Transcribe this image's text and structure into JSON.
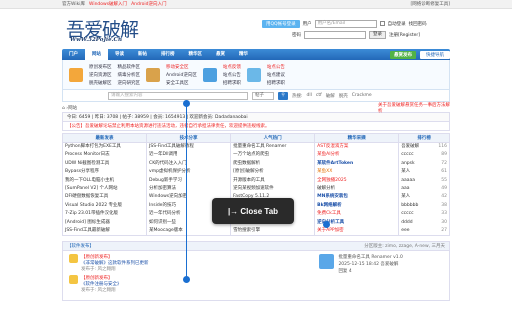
{
  "topbar": {
    "left": "官方Wiki库",
    "left_link": "Windows破解入门",
    "left_link2": "Android逆向入门",
    "right": "[网络诊断修复工具]"
  },
  "logo": {
    "big": "吾爱破解",
    "url": "WwW.52PoJie.Cn"
  },
  "login": {
    "qq": "用QQ帐号登录",
    "user_ph": "用户名/Email",
    "pass_ph": "",
    "autologin": "自动登录",
    "find_pw": "找回密码",
    "login_btn": "登录",
    "register": "注册[Register]"
  },
  "nav": {
    "items": [
      "门户",
      "网站",
      "导读",
      "新帖",
      "排行榜",
      "精华区",
      "悬赏",
      "精华"
    ],
    "green": "悬赏发布",
    "quick": "快捷导航"
  },
  "subnav": {
    "c1": [
      "原创发布区",
      "逆向资源区",
      "脱壳破解区"
    ],
    "c2": [
      "精品软件区",
      "病毒分析区",
      "逆向研究区"
    ],
    "c3": [
      "移动安全区",
      "Android逆向区",
      "安全工具区"
    ],
    "c4": [
      "站点反馈",
      "站点公告",
      "招聘求职"
    ],
    "c5": [
      "站点公告",
      "站点建议",
      "招聘求职"
    ]
  },
  "search": {
    "placeholder": "请输入搜索内容",
    "select": "帖子",
    "hot_label": "热搜:",
    "hot": [
      "dll",
      "ctf",
      "破解",
      "脱壳",
      "Crackme"
    ]
  },
  "crumb": "网站",
  "stats": {
    "left": "今日: 6459 | 昨日: 3708 | 帖子: 38959 | 会员: 1654913 | 欢迎新会员: Dadadanaobai",
    "right": "关于吾爱破解悬赏任务—事后方法解析"
  },
  "notice": "【公告】吾爱破解论坛禁止利用本站资源进行违法活动，违者自行承担法律责任，欢迎提供违规线索。",
  "rightad": "关于吾爱破解悬赏任务—事后方法解析",
  "grid": {
    "heads": [
      "最新发表",
      "技术分享",
      "人气热门",
      "精华采撷",
      "排行榜"
    ],
    "col1": [
      "Python脚本打包为EXE工具",
      "Process Monitor日志",
      "UDW Ni截图检测工具",
      "Bypass分享程序",
      "我的一下OLL电脑小主机",
      "[SumPanel V2] 个人网站",
      "DFl硬盘数据恢复工具",
      "Visual Studio 2022 专业版",
      "7-Zip 23.01带插件汉化版",
      "[Android] 图标生成器",
      "JSS-Find工具最新破解"
    ],
    "col2": [
      "JSS-Find工具破解教程",
      "近一年Dll调用",
      "CK的代码注入入门",
      "vmp虚拟机保护分析",
      "Debug新手学习",
      "分析加密算法",
      "Windows逆向加密",
      "Inside的技巧",
      "近一年代码分析",
      "如何识别一些",
      "某Moocage版本"
    ],
    "col3": [
      "批量重命名工具 Renamer",
      "一万个站点的爬虫",
      "爬虫数据解析",
      "[原创]破解分析",
      "开源版本的工具",
      "逆向某视频加速软件",
      "FastCopy 5.11.2",
      "CloudNode网络工具",
      "Screenshot",
      "python实现下载器",
      "雪豹搜索引擎"
    ],
    "col4": [
      "AST反混淆方案",
      "某鱼AI分析",
      "某软件ArtToken",
      "某鱼XX",
      "全网独播2025",
      "破解分析",
      "MN系统安装包",
      "Bk网络解析",
      "免费Ck工具",
      "逆向分析工具",
      "关于APP加密"
    ],
    "col5r": [
      "吾爱破解",
      "ccccc",
      "anpsk",
      "某人",
      "aaaaa",
      "aaa",
      "某人",
      "bbbbbb",
      "ccccc",
      "dddd",
      "eee"
    ],
    "col5n": [
      "116",
      "89",
      "72",
      "61",
      "55",
      "49",
      "42",
      "38",
      "33",
      "30",
      "27"
    ]
  },
  "section": {
    "left": "【软件发布】",
    "right": "分区版主: zimo, zzage, A-new, 三月天"
  },
  "posts": [
    {
      "title": "【原创新发布】",
      "detail": "《非常破解》这款软件系列已更新",
      "meta": "发布于: 风之翱翔"
    },
    {
      "title": "【原创新发布】",
      "detail": "《软件注册与安全》",
      "meta": "发布于: 风之翱翔"
    }
  ],
  "post2": {
    "line1": "批量重命名工具 Renamer v1.0",
    "line2": "2025-12-15 18:42 吾爱破解",
    "line3": "回复 4"
  },
  "tooltip": "|→ Close Tab"
}
